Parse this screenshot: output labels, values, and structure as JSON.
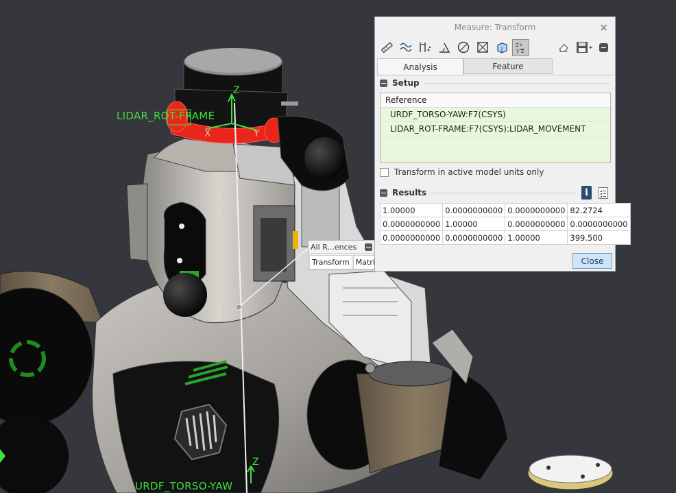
{
  "viewport": {
    "labels": {
      "lidar_frame": "LIDAR_ROT-FRAME",
      "torso_frame": "URDF_TORSO-YAW",
      "axis_z_top": "Z",
      "axis_x": "X",
      "axis_y": "Y",
      "axis_z_bottom": "Z"
    },
    "colors": {
      "label_green": "#3fe03f",
      "highlight_red": "#e8261b",
      "background": "#36373d"
    }
  },
  "ref_widget": {
    "title": "All R...ences",
    "tabs": [
      "Transform",
      "Matrix"
    ]
  },
  "dialog": {
    "title": "Measure: Transform",
    "close_icon": "×",
    "toolbar_icons": [
      "ruler-icon",
      "curve-length-icon",
      "distance-icon",
      "angle-icon",
      "diameter-icon",
      "area-icon",
      "volume-icon",
      "transform-icon",
      "eraser-icon",
      "save-icon"
    ],
    "tabs": {
      "analysis": "Analysis",
      "feature": "Feature"
    },
    "setup": {
      "header": "Setup",
      "reference_header": "Reference",
      "references": [
        "URDF_TORSO-YAW:F7(CSYS)",
        "LIDAR_ROT-FRAME:F7(CSYS):LIDAR_MOVEMENT"
      ],
      "checkbox_label": "Transform in active model units only",
      "checkbox_checked": false
    },
    "results": {
      "header": "Results",
      "matrix": [
        [
          "1.00000",
          "0.0000000000",
          "0.0000000000",
          "82.2724"
        ],
        [
          "0.0000000000",
          "1.00000",
          "0.0000000000",
          "0.0000000000"
        ],
        [
          "0.0000000000",
          "0.0000000000",
          "1.00000",
          "399.500"
        ]
      ]
    },
    "close_button": "Close"
  }
}
